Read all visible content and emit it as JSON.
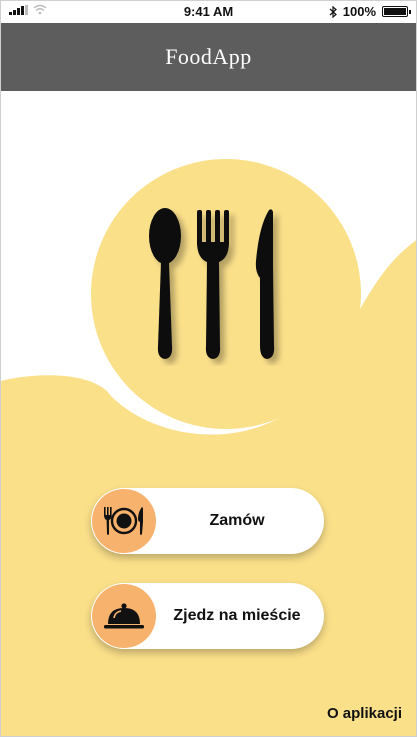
{
  "status_bar": {
    "time": "9:41 AM",
    "battery": "100%",
    "icons": [
      "signal-icon",
      "wifi-icon",
      "bluetooth-icon",
      "battery-icon"
    ]
  },
  "header": {
    "title": "FoodApp"
  },
  "hero": {
    "icon": "cutlery-icon"
  },
  "menu": {
    "order": {
      "label": "Zamów",
      "icon": "plate-cutlery-icon"
    },
    "eat_out": {
      "label": "Zjedz na mieście",
      "icon": "cloche-icon"
    }
  },
  "footer": {
    "about_label": "O aplikacji"
  },
  "colors": {
    "header_bg": "#5d5d5d",
    "accent_yellow": "#fbe08a",
    "icon_orange": "#f7b26e",
    "background": "#ffffff"
  }
}
